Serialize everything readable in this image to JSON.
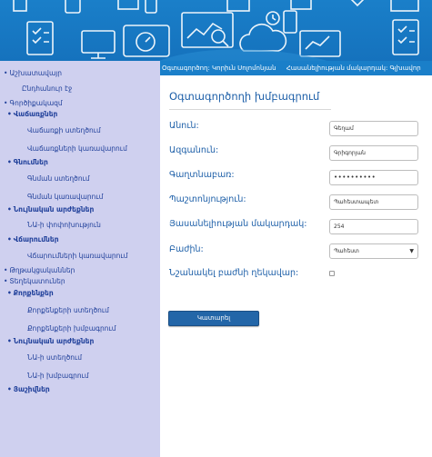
{
  "colors": {
    "banner_blue": "#1a7fc9",
    "sidebar_bg": "#cfd0ef",
    "link_blue": "#1f3f9a",
    "label_blue": "#1d5fa8",
    "button_blue": "#2366a8"
  },
  "banner": {
    "icons": [
      "document-check-icon",
      "monitor-icon",
      "devices-icon",
      "analytics-icon",
      "cloud-icon",
      "clock-icon",
      "gauge-icon",
      "mobile-icon",
      "checklist-icon"
    ]
  },
  "infobar": {
    "user": "Օգտագործող: Կորիւն Սոլոմոնյան",
    "access": "Հասանելիության մակարդակ: Գլխավոր"
  },
  "sidebar": {
    "items": [
      {
        "label": "Աշխատավայր",
        "bullet": "•"
      },
      {
        "label": "Ընդհանուր էջ",
        "bullet": ""
      },
      {
        "label": "Գործիքակազմ",
        "bullet": "•"
      },
      {
        "label": "Վաճառքներ",
        "bullet": "•"
      },
      {
        "label": "Վաճառքի ստեղծում",
        "bullet": ""
      },
      {
        "label": "Վաճառքների կառավարում",
        "bullet": ""
      },
      {
        "label": "Գնումներ",
        "bullet": "•"
      },
      {
        "label": "Գնման ստեղծում",
        "bullet": ""
      },
      {
        "label": "Գնման կառավարում",
        "bullet": ""
      },
      {
        "label": "Նույնական արժեքներ",
        "bullet": "•"
      },
      {
        "label": "ՆԱ-ի փոփոխություն",
        "bullet": ""
      },
      {
        "label": "Վճարումներ",
        "bullet": "•"
      },
      {
        "label": "Վճարումների կառավարում",
        "bullet": ""
      },
      {
        "label": "Թղթակցականներ",
        "bullet": "•"
      },
      {
        "label": "Տեղեկատուներ",
        "bullet": "•"
      },
      {
        "label": "Քորքենքեր",
        "bullet": "•"
      },
      {
        "label": "Քորքենքերի ստեղծում",
        "bullet": ""
      },
      {
        "label": "Քորքենքերի խմբագրում",
        "bullet": ""
      },
      {
        "label": "Նույնական արժեքներ",
        "bullet": "•"
      },
      {
        "label": "ՆԱ-ի ստեղծում",
        "bullet": ""
      },
      {
        "label": "ՆԱ-ի խմբագրում",
        "bullet": ""
      },
      {
        "label": "Յաշիվներ",
        "bullet": "•"
      }
    ]
  },
  "form": {
    "title": "Օգտագործողի խմբագրում",
    "fields": {
      "first_name": {
        "label": "Անուն:",
        "value": "Գեղամ"
      },
      "last_name": {
        "label": "Ազգանուն:",
        "value": "Գրիգորյան"
      },
      "password": {
        "label": "Գաղտնաբառ:",
        "value": "••••••••••"
      },
      "position": {
        "label": "Պաշտոնյություն:",
        "value": "Պահեստապետ"
      },
      "access_level": {
        "label": "Յասանելիության մակարդակ:",
        "value": "254"
      },
      "department": {
        "label": "Բաժին:",
        "value": "Պահեստ"
      },
      "dept_head": {
        "label": "Նշանակել բաժնի ղեկավար:",
        "checked": false
      }
    },
    "save_label": "Կատարել"
  }
}
